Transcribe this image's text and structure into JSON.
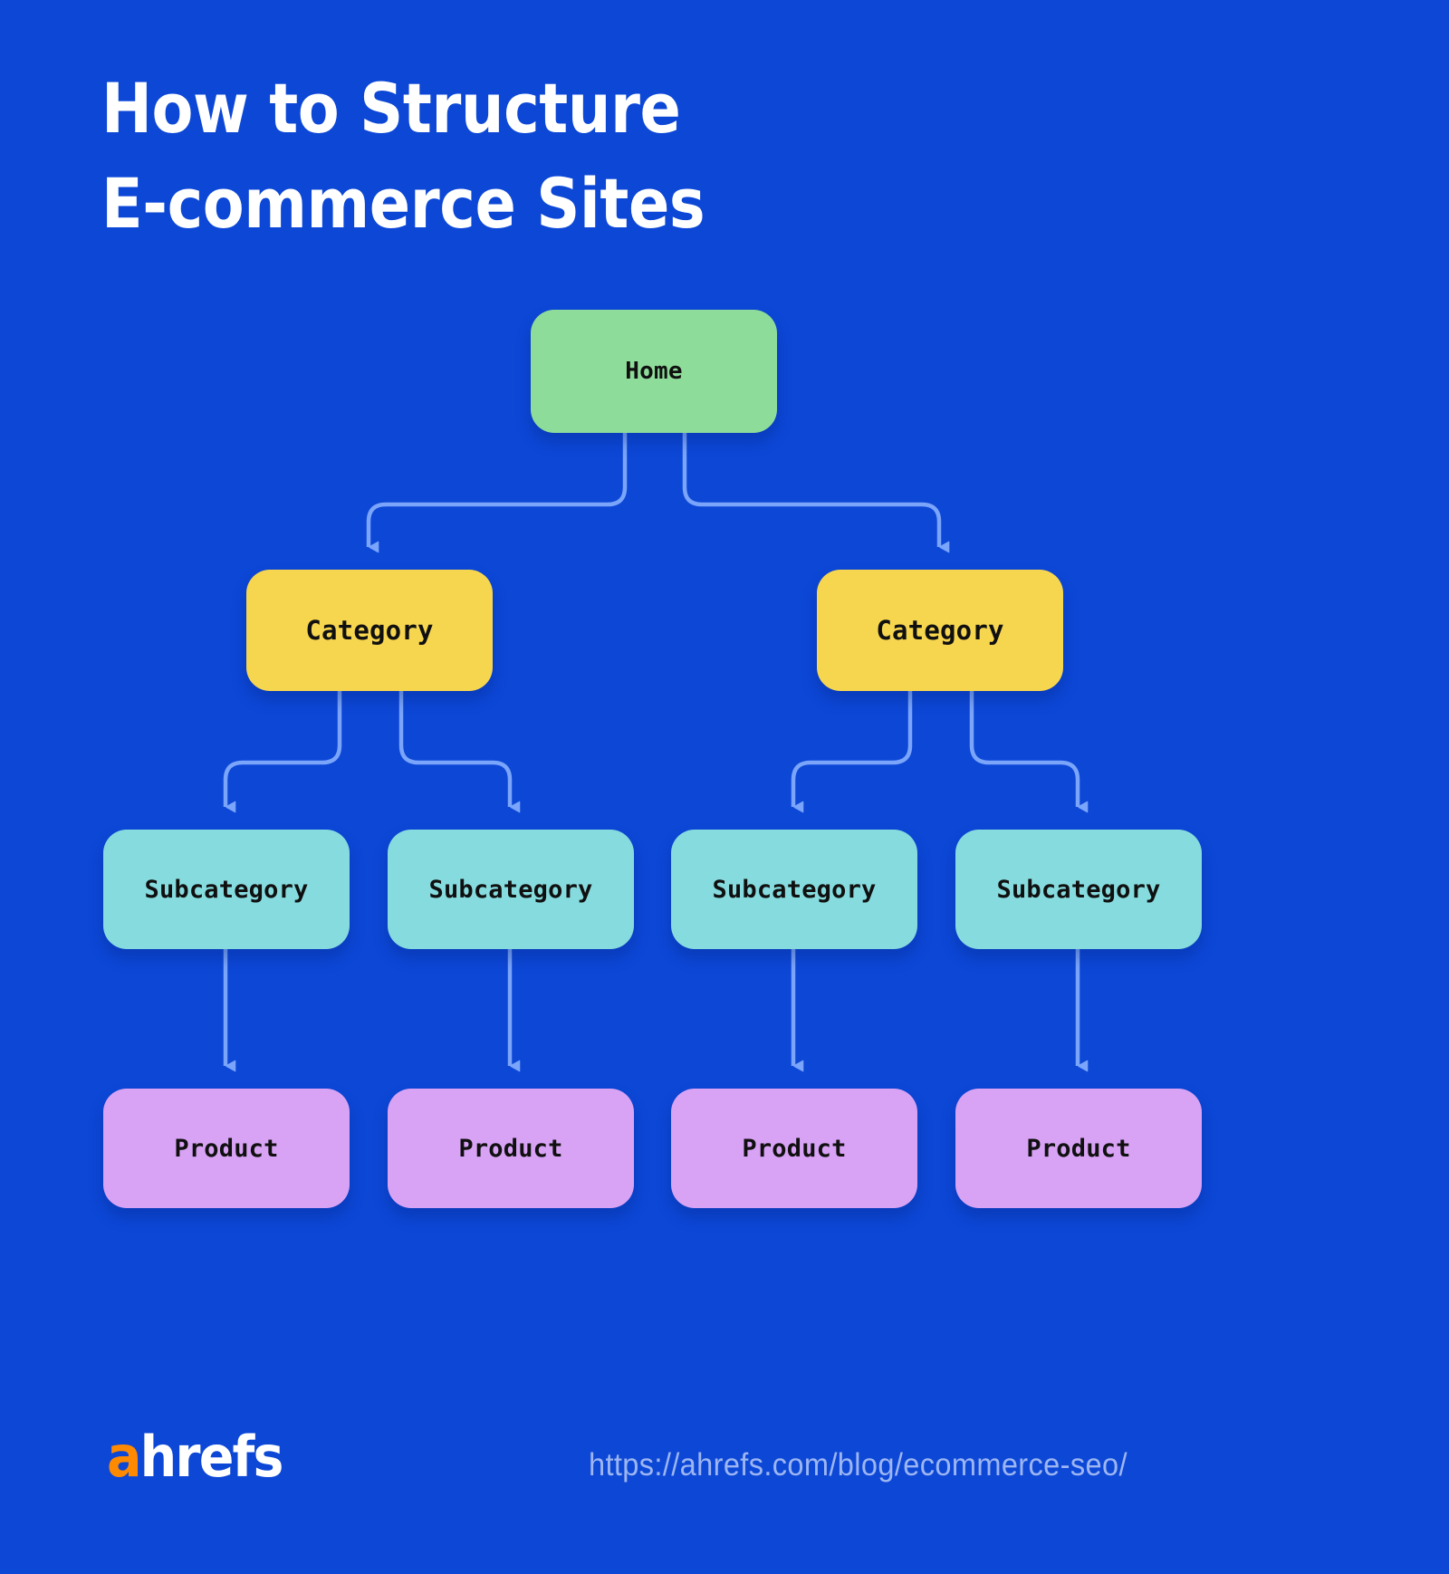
{
  "background_color": "#0C47D6",
  "title": {
    "line1": "How to Structure",
    "line2": "E-commerce Sites",
    "color": "#FFFFFF"
  },
  "diagram": {
    "levels": [
      {
        "name": "home",
        "color": "#8EDC9A",
        "nodes": [
          {
            "label": "Home"
          }
        ]
      },
      {
        "name": "category",
        "color": "#F7D64F",
        "nodes": [
          {
            "label": "Category"
          },
          {
            "label": "Category"
          }
        ]
      },
      {
        "name": "subcategory",
        "color": "#86DBDE",
        "nodes": [
          {
            "label": "Subcategory"
          },
          {
            "label": "Subcategory"
          },
          {
            "label": "Subcategory"
          },
          {
            "label": "Subcategory"
          }
        ]
      },
      {
        "name": "product",
        "color": "#D9A3F5",
        "nodes": [
          {
            "label": "Product"
          },
          {
            "label": "Product"
          },
          {
            "label": "Product"
          },
          {
            "label": "Product"
          }
        ]
      }
    ],
    "connector_color": "#7AA5FA"
  },
  "footer": {
    "logo": {
      "accent": "a",
      "rest": "hrefs",
      "accent_color": "#FF8A00",
      "rest_color": "#FFFFFF"
    },
    "url": "https://ahrefs.com/blog/ecommerce-seo/",
    "url_color": "#9DB6F2"
  }
}
